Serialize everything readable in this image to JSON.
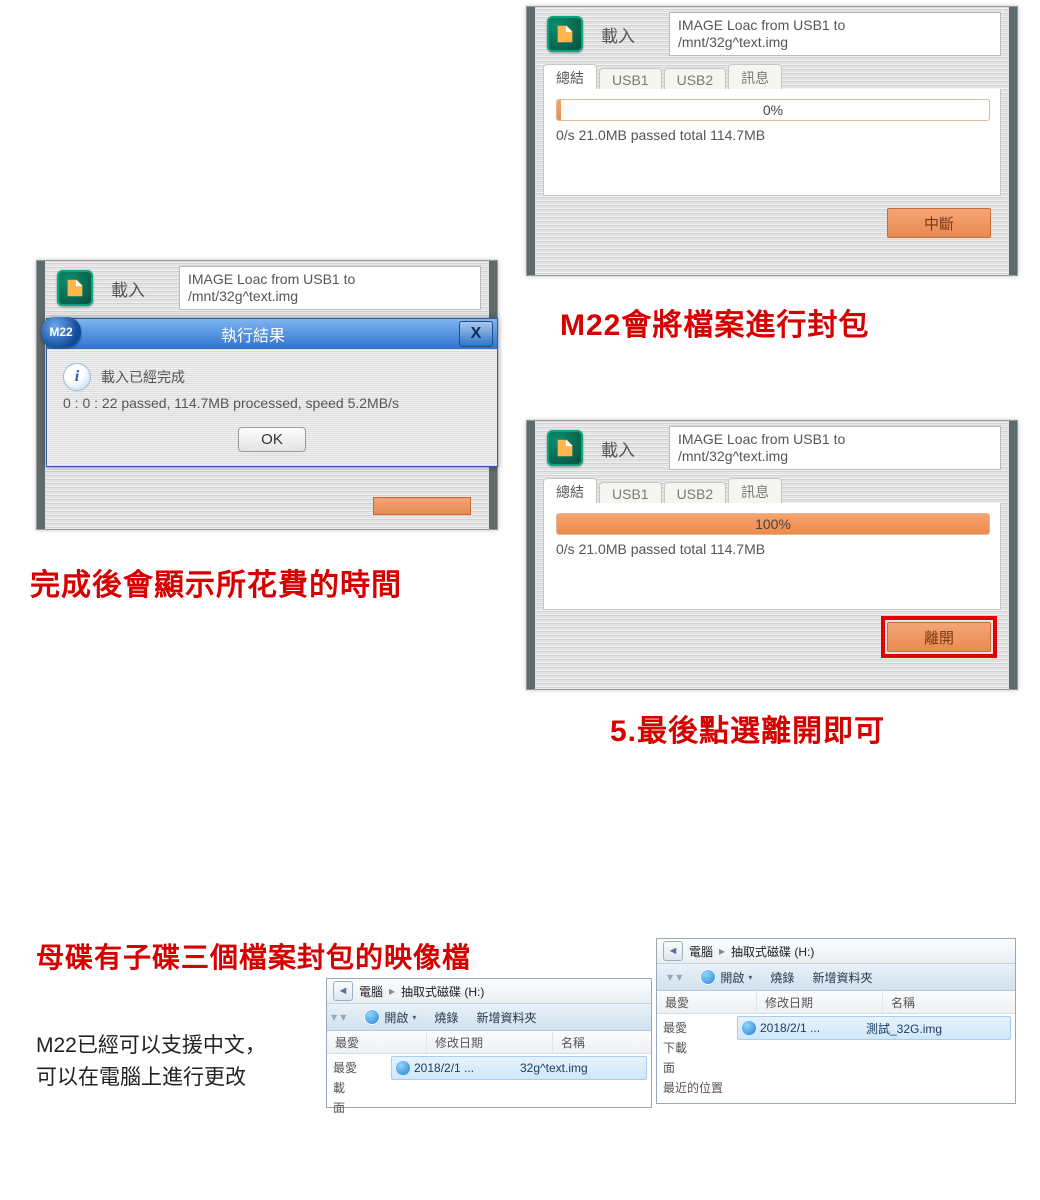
{
  "windows": {
    "top_right": {
      "title": "載入",
      "path_line1": "IMAGE Loac from USB1 to",
      "path_line2": "/mnt/32g^text.img",
      "tabs": [
        "總結",
        "USB1",
        "USB2",
        "訊息"
      ],
      "progress_pct": "0%",
      "progress_fill_pct": 1,
      "stats": "0/s  21.0MB  passed  total  114.7MB",
      "button": "中斷"
    },
    "mid_right": {
      "title": "載入",
      "path_line1": "IMAGE Loac from USB1 to",
      "path_line2": "/mnt/32g^text.img",
      "tabs": [
        "總結",
        "USB1",
        "USB2",
        "訊息"
      ],
      "progress_pct": "100%",
      "progress_fill_pct": 100,
      "stats": "0/s  21.0MB  passed  total  114.7MB",
      "button": "離開"
    },
    "left_behind": {
      "title": "載入",
      "path_line1": "IMAGE Loac from USB1 to",
      "path_line2": "/mnt/32g^text.img"
    },
    "modal": {
      "badge": "M22",
      "title": "執行結果",
      "close": "X",
      "info_glyph": "i",
      "line1": "載入已經完成",
      "line2": "0 : 0 : 22 passed, 114.7MB processed, speed 5.2MB/s",
      "ok": "OK"
    }
  },
  "captions": {
    "top_right": "M22會將檔案進行封包",
    "left_done": "完成後會顯示所花費的時間",
    "step5": "5.最後點選離開即可",
    "master_child": "母碟有子碟三個檔案封包的映像檔"
  },
  "note": {
    "line1": "M22已經可以支援中文，",
    "line2": "可以在電腦上進行更改"
  },
  "explorer_left": {
    "crumb1": "電腦",
    "crumb2": "抽取式磁碟 (H:)",
    "tb_open": "開啟",
    "tb_burn": "燒錄",
    "tb_newfolder": "新增資料夾",
    "col_fav": "最愛",
    "col_date": "修改日期",
    "col_name": "名稱",
    "side": [
      "最愛",
      "載",
      "面"
    ],
    "file_date": "2018/2/1 ...",
    "file_name": "32g^text.img"
  },
  "explorer_right": {
    "crumb1": "電腦",
    "crumb2": "抽取式磁碟 (H:)",
    "tb_open": "開啟",
    "tb_burn": "燒錄",
    "tb_newfolder": "新增資料夾",
    "col_fav": "最愛",
    "col_date": "修改日期",
    "col_name": "名稱",
    "side": [
      "最愛",
      "下載",
      "面",
      "最近的位置"
    ],
    "file_date": "2018/2/1 ...",
    "file_name": "測試_32G.img"
  }
}
